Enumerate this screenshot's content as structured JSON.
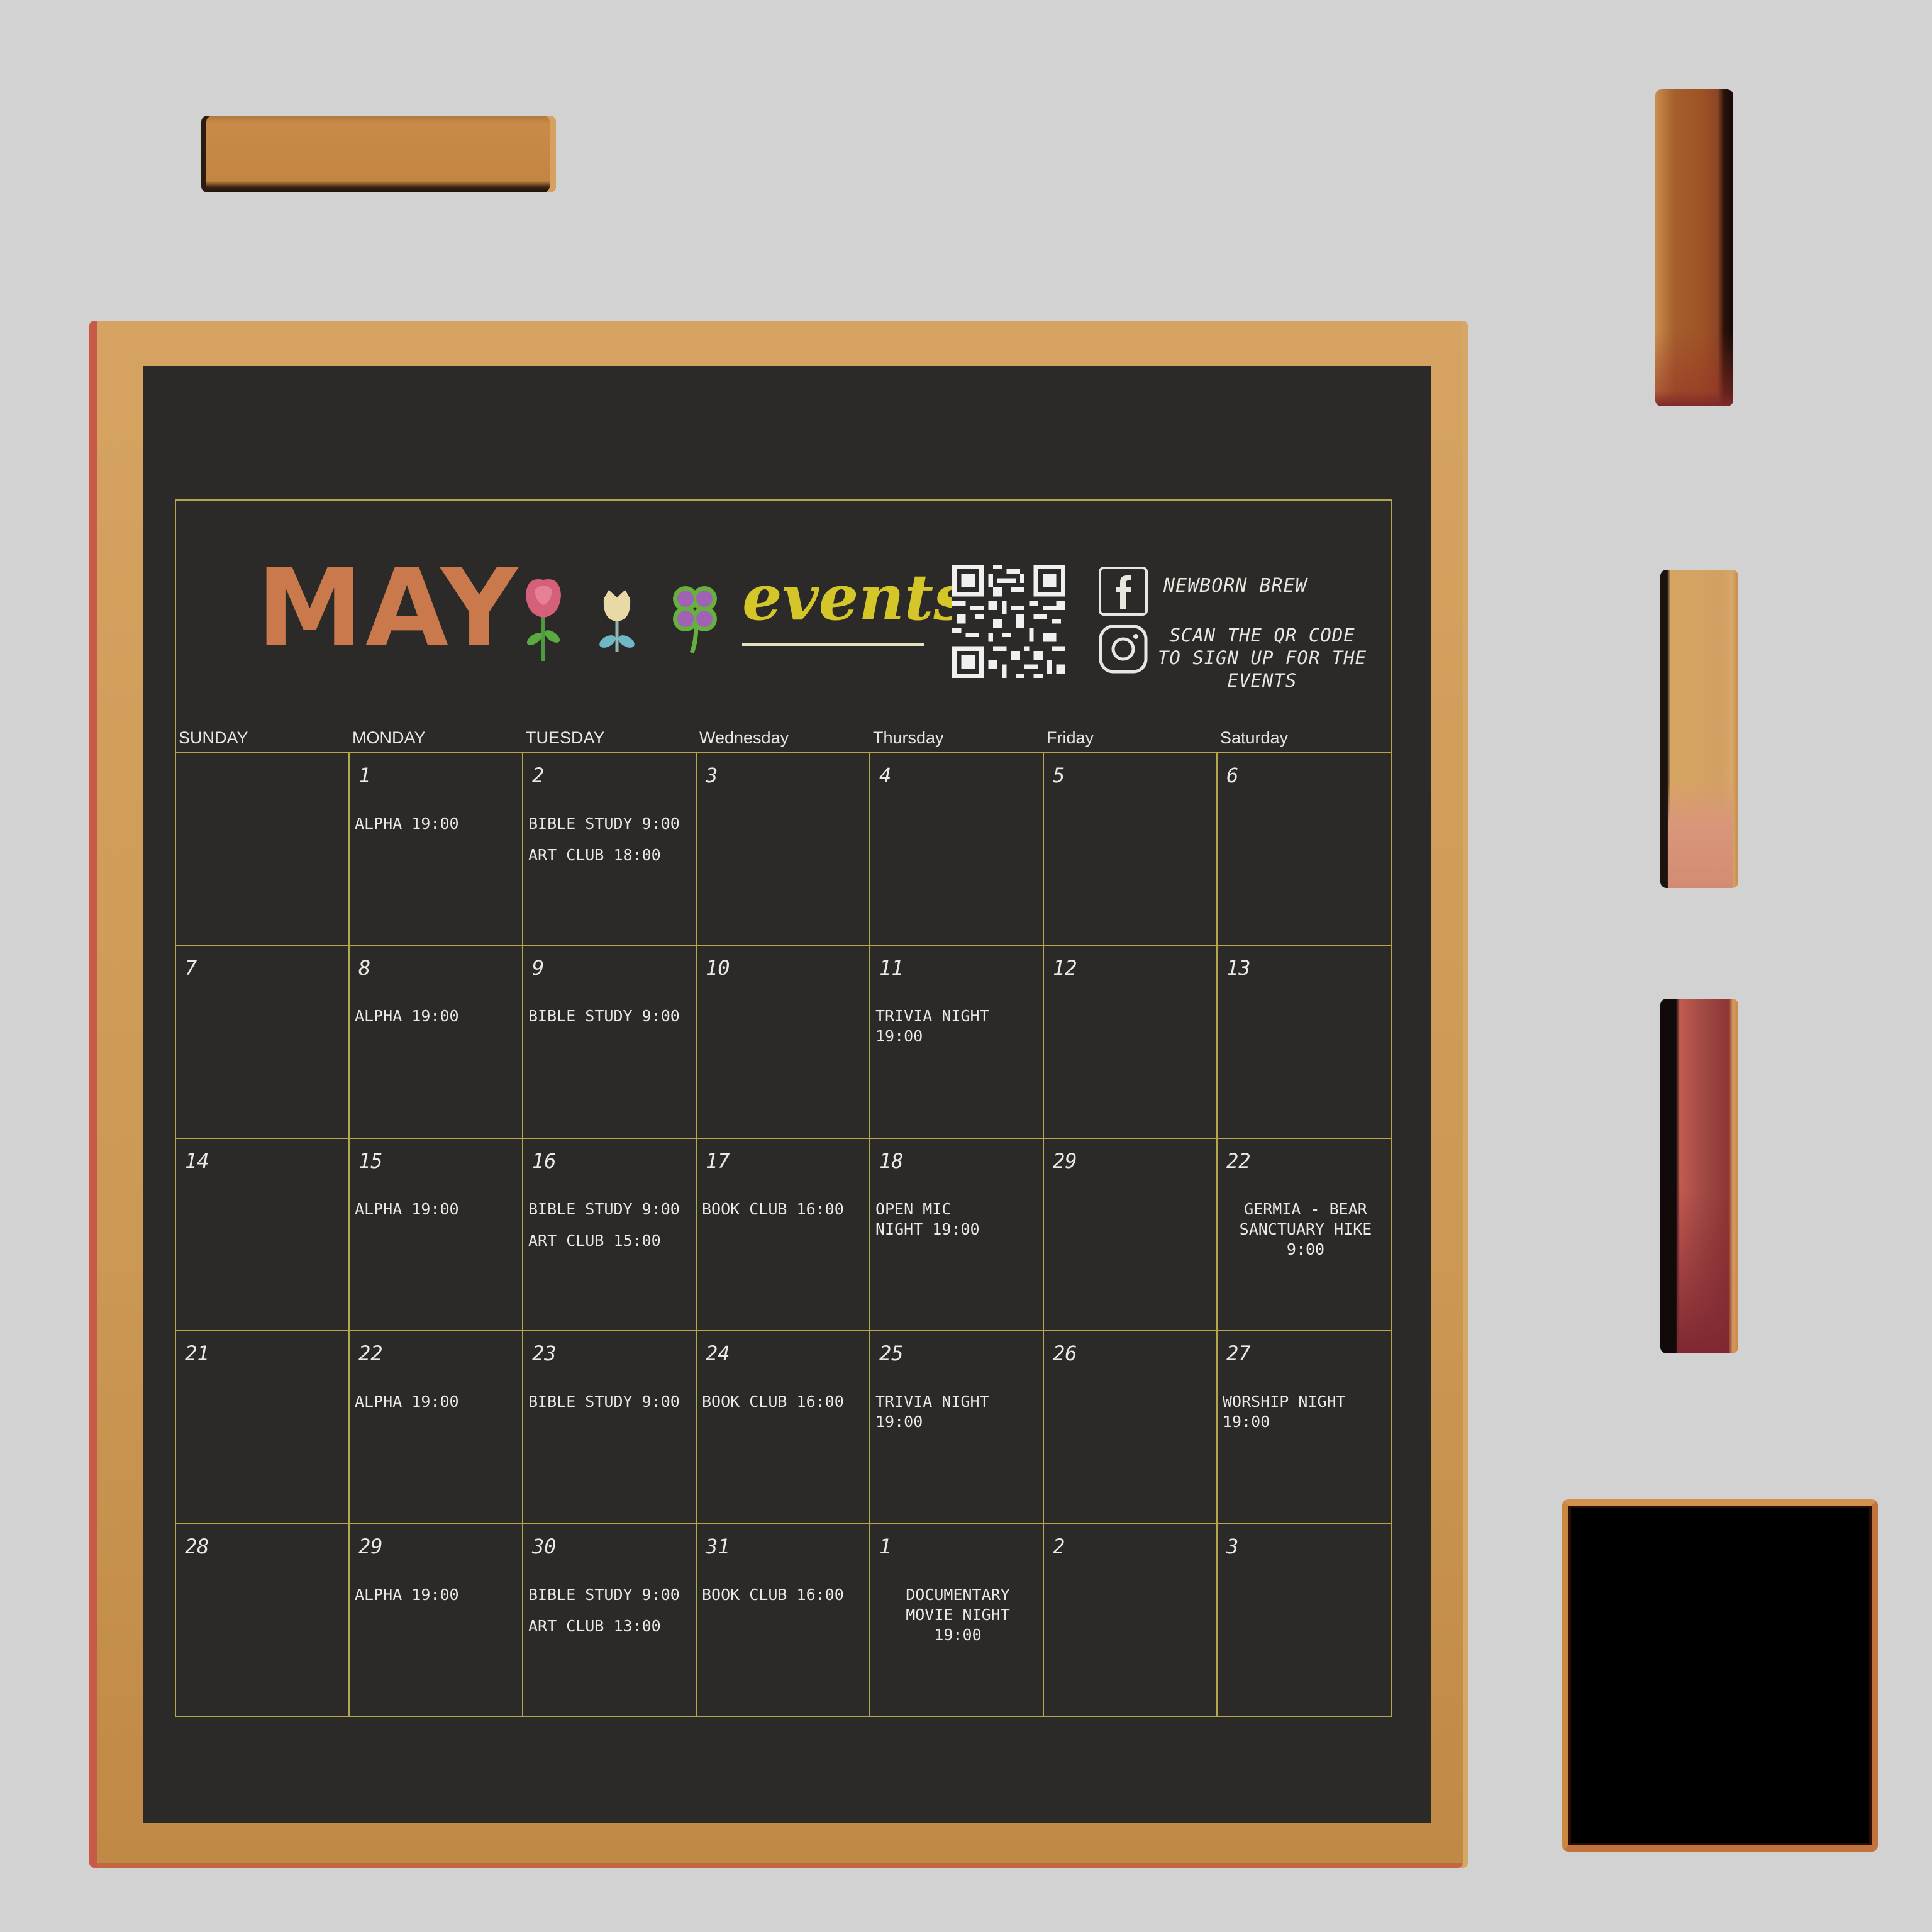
{
  "title": {
    "month": "MAY",
    "events_word": "events",
    "brand": "NEWBORN BREW",
    "scan_text": "SCAN THE QR CODE TO SIGN UP FOR THE EVENTS"
  },
  "icons": [
    "rose-icon",
    "tulip-icon",
    "clover-icon",
    "qr-code",
    "facebook-icon",
    "instagram-icon"
  ],
  "colors": {
    "chalkboard": "#2c2a28",
    "frame_wood": "#cc9855",
    "grid_line": "#b4a64a",
    "month_text": "#c9794c",
    "events_text": "#d4c629"
  },
  "calendar": {
    "days_of_week": [
      "SUNDAY",
      "MONDAY",
      "TUESDAY",
      "Wednesday",
      "Thursday",
      "Friday",
      "Saturday"
    ],
    "weeks": [
      [
        {
          "day": "",
          "events": []
        },
        {
          "day": "1",
          "events": [
            "ALPHA 19:00"
          ]
        },
        {
          "day": "2",
          "events": [
            "BIBLE STUDY 9:00",
            "ART CLUB 18:00"
          ]
        },
        {
          "day": "3",
          "events": []
        },
        {
          "day": "4",
          "events": []
        },
        {
          "day": "5",
          "events": []
        },
        {
          "day": "6",
          "events": []
        }
      ],
      [
        {
          "day": "7",
          "events": []
        },
        {
          "day": "8",
          "events": [
            "ALPHA 19:00"
          ]
        },
        {
          "day": "9",
          "events": [
            "BIBLE STUDY 9:00"
          ]
        },
        {
          "day": "10",
          "events": []
        },
        {
          "day": "11",
          "events": [
            "TRIVIA NIGHT\n 19:00"
          ]
        },
        {
          "day": "12",
          "events": []
        },
        {
          "day": "13",
          "events": []
        }
      ],
      [
        {
          "day": "14",
          "events": []
        },
        {
          "day": "15",
          "events": [
            "ALPHA 19:00"
          ]
        },
        {
          "day": "16",
          "events": [
            "BIBLE STUDY 9:00",
            "ART CLUB 15:00"
          ]
        },
        {
          "day": "17",
          "events": [
            "BOOK CLUB 16:00"
          ]
        },
        {
          "day": "18",
          "events": [
            "OPEN MIC\nNIGHT  19:00"
          ]
        },
        {
          "day": "29",
          "events": []
        },
        {
          "day": "22",
          "events": [
            "GERMIA - BEAR\nSANCTUARY HIKE\n9:00"
          ],
          "center": true
        }
      ],
      [
        {
          "day": "21",
          "events": []
        },
        {
          "day": "22",
          "events": [
            "ALPHA 19:00"
          ]
        },
        {
          "day": "23",
          "events": [
            "BIBLE STUDY 9:00"
          ]
        },
        {
          "day": "24",
          "events": [
            "BOOK CLUB 16:00"
          ]
        },
        {
          "day": "25",
          "events": [
            "TRIVIA NIGHT\n 19:00"
          ]
        },
        {
          "day": "26",
          "events": []
        },
        {
          "day": "27",
          "events": [
            "WORSHIP NIGHT\n 19:00"
          ]
        }
      ],
      [
        {
          "day": "28",
          "events": []
        },
        {
          "day": "29",
          "events": [
            "ALPHA 19:00"
          ]
        },
        {
          "day": "30",
          "events": [
            "BIBLE STUDY 9:00",
            "ART CLUB 13:00"
          ]
        },
        {
          "day": "31",
          "events": [
            "BOOK CLUB 16:00"
          ]
        },
        {
          "day": "1",
          "events": [
            "DOCUMENTARY\nMOVIE NIGHT\n19:00"
          ],
          "center": true
        },
        {
          "day": "2",
          "events": []
        },
        {
          "day": "3",
          "events": []
        }
      ]
    ]
  }
}
